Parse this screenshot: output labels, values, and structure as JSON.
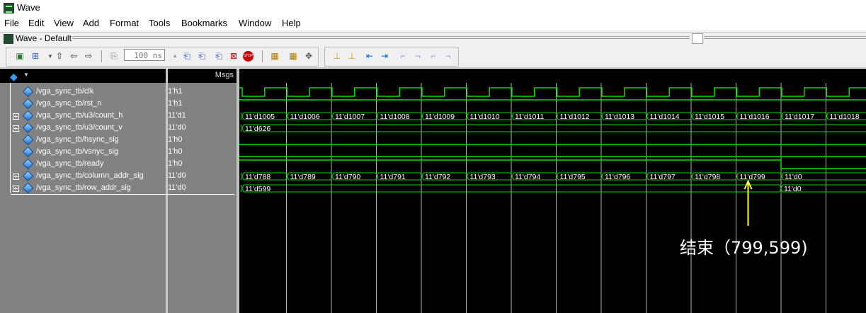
{
  "window": {
    "title": "Wave"
  },
  "menu": [
    "File",
    "Edit",
    "View",
    "Add",
    "Format",
    "Tools",
    "Bookmarks",
    "Window",
    "Help"
  ],
  "subwindow": {
    "title": "Wave - Default"
  },
  "toolbar": {
    "run_length": "100 ns",
    "icons": [
      "save-dataset-icon",
      "add-wave-icon",
      "up-icon",
      "back-arrow-icon",
      "forward-arrow-icon",
      "restart-icon",
      "run-icon",
      "continue-icon",
      "run-all-icon",
      "break-icon",
      "stop-icon",
      "find-icon",
      "find-cursor-icon",
      "zoom-icon",
      "cursor-add-icon",
      "cursor-delete-icon",
      "cursor-prev-icon",
      "cursor-next-icon",
      "edge-prev-icon",
      "edge-next-icon",
      "edge-rise-icon",
      "edge-fall-icon"
    ]
  },
  "header": {
    "msgs_label": "Msgs"
  },
  "signals": [
    {
      "name": "/vga_sync_tb/clk",
      "value": "1'h1",
      "expandable": false
    },
    {
      "name": "/vga_sync_tb/rst_n",
      "value": "1'h1",
      "expandable": false
    },
    {
      "name": "/vga_sync_tb/u3/count_h",
      "value": "11'd1",
      "expandable": true
    },
    {
      "name": "/vga_sync_tb/u3/count_v",
      "value": "11'd0",
      "expandable": true
    },
    {
      "name": "/vga_sync_tb/hsync_sig",
      "value": "1'h0",
      "expandable": false
    },
    {
      "name": "/vga_sync_tb/vsnyc_sig",
      "value": "1'h0",
      "expandable": false
    },
    {
      "name": "/vga_sync_tb/ready",
      "value": "1'h0",
      "expandable": false
    },
    {
      "name": "/vga_sync_tb/column_addr_sig",
      "value": "11'd0",
      "expandable": true
    },
    {
      "name": "/vga_sync_tb/row_addr_sig",
      "value": "11'd0",
      "expandable": true
    }
  ],
  "waves": {
    "count_h": [
      "11'd1005",
      "11'd1006",
      "11'd1007",
      "11'd1008",
      "11'd1009",
      "11'd1010",
      "11'd1011",
      "11'd1012",
      "11'd1013",
      "11'd1014",
      "11'd1015",
      "11'd1016",
      "11'd1017",
      "11'd1018"
    ],
    "count_v": [
      "11'd626"
    ],
    "column_addr": [
      "11'd788",
      "11'd789",
      "11'd790",
      "11'd791",
      "11'd792",
      "11'd793",
      "11'd794",
      "11'd795",
      "11'd796",
      "11'd797",
      "11'd798",
      "11'd799",
      "11'd0"
    ],
    "row_addr": [
      "11'd599",
      "11'd0"
    ]
  },
  "annotation": {
    "text": "结束（799,599)"
  },
  "colors": {
    "wave": "#00e000",
    "grid": "#c8c8c8",
    "cursor": "#ffff40",
    "background": "#000000"
  }
}
